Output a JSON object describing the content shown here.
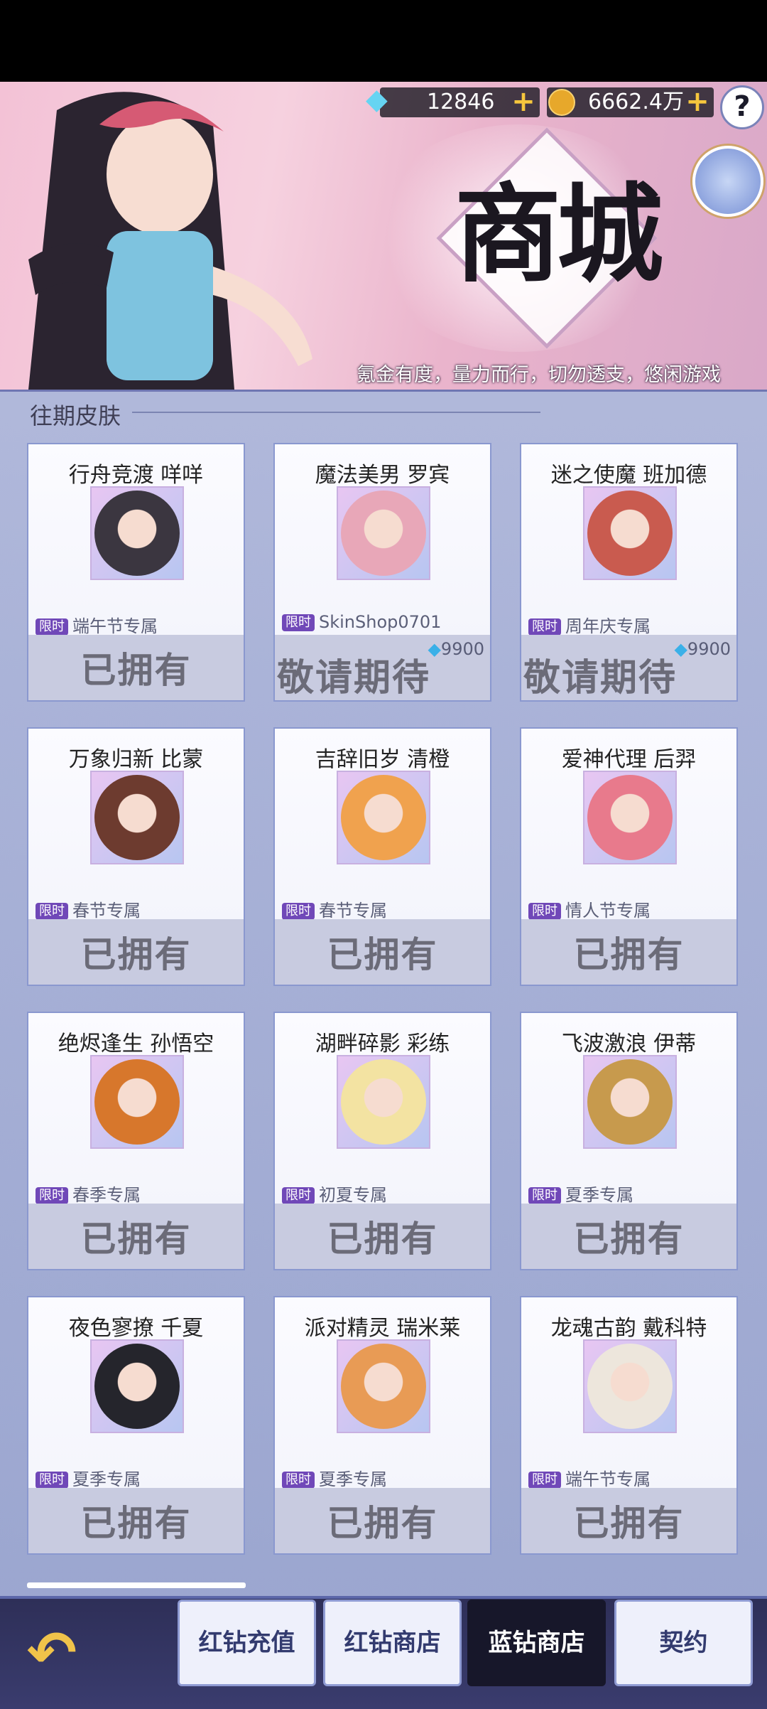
{
  "header": {
    "diamonds": "12846",
    "coins": "6662.4万",
    "help_label": "?",
    "logo_text": "商城",
    "slogan": "氪金有度，量力而行，切勿透支，悠闲游戏"
  },
  "section": {
    "title": "往期皮肤"
  },
  "limit_badge": "限时",
  "cards": [
    {
      "name": "行舟竞渡 咩咩",
      "tag": "端午节专属",
      "status": "已拥有",
      "price": ""
    },
    {
      "name": "魔法美男 罗宾",
      "tag": "SkinShop0701",
      "status": "敬请期待",
      "price": "9900"
    },
    {
      "name": "迷之使魔 班加德",
      "tag": "周年庆专属",
      "status": "敬请期待",
      "price": "9900"
    },
    {
      "name": "万象归新 比蒙",
      "tag": "春节专属",
      "status": "已拥有",
      "price": ""
    },
    {
      "name": "吉辞旧岁 清橙",
      "tag": "春节专属",
      "status": "已拥有",
      "price": ""
    },
    {
      "name": "爱神代理 后羿",
      "tag": "情人节专属",
      "status": "已拥有",
      "price": ""
    },
    {
      "name": "绝烬逢生 孙悟空",
      "tag": "春季专属",
      "status": "已拥有",
      "price": ""
    },
    {
      "name": "湖畔碎影 彩练",
      "tag": "初夏专属",
      "status": "已拥有",
      "price": ""
    },
    {
      "name": "飞波激浪 伊蒂",
      "tag": "夏季专属",
      "status": "已拥有",
      "price": ""
    },
    {
      "name": "夜色寥撩 千夏",
      "tag": "夏季专属",
      "status": "已拥有",
      "price": ""
    },
    {
      "name": "派对精灵 瑞米莱",
      "tag": "夏季专属",
      "status": "已拥有",
      "price": ""
    },
    {
      "name": "龙魂古韵 戴科特",
      "tag": "端午节专属",
      "status": "已拥有",
      "price": ""
    }
  ],
  "portrait_colors": [
    "#3b3640",
    "#e8a7b8",
    "#c95b4f",
    "#6d3b2f",
    "#f0a24e",
    "#e87a8c",
    "#d7772c",
    "#f3e3a2",
    "#c79a4d",
    "#25252c",
    "#e89b55",
    "#ede6dc"
  ],
  "nav": {
    "back_icon": "back-arrow-icon",
    "tabs": [
      "红钻充值",
      "红钻商店",
      "蓝钻商店",
      "契约"
    ],
    "active_tab": 2
  }
}
